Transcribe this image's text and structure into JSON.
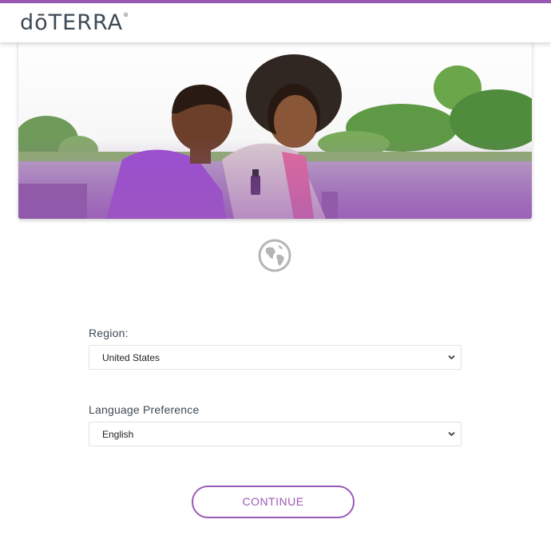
{
  "brand": {
    "logo_text": "dōTERRA",
    "logo_mark": "®",
    "accent_color": "#9b59b6"
  },
  "hero": {
    "alt": "Couple by a lake with essential oil"
  },
  "globe_icon": "globe-icon",
  "region": {
    "label": "Region:",
    "selected": "United States"
  },
  "language": {
    "label": "Language Preference",
    "selected": "English"
  },
  "continue_button": {
    "label": "CONTINUE"
  }
}
